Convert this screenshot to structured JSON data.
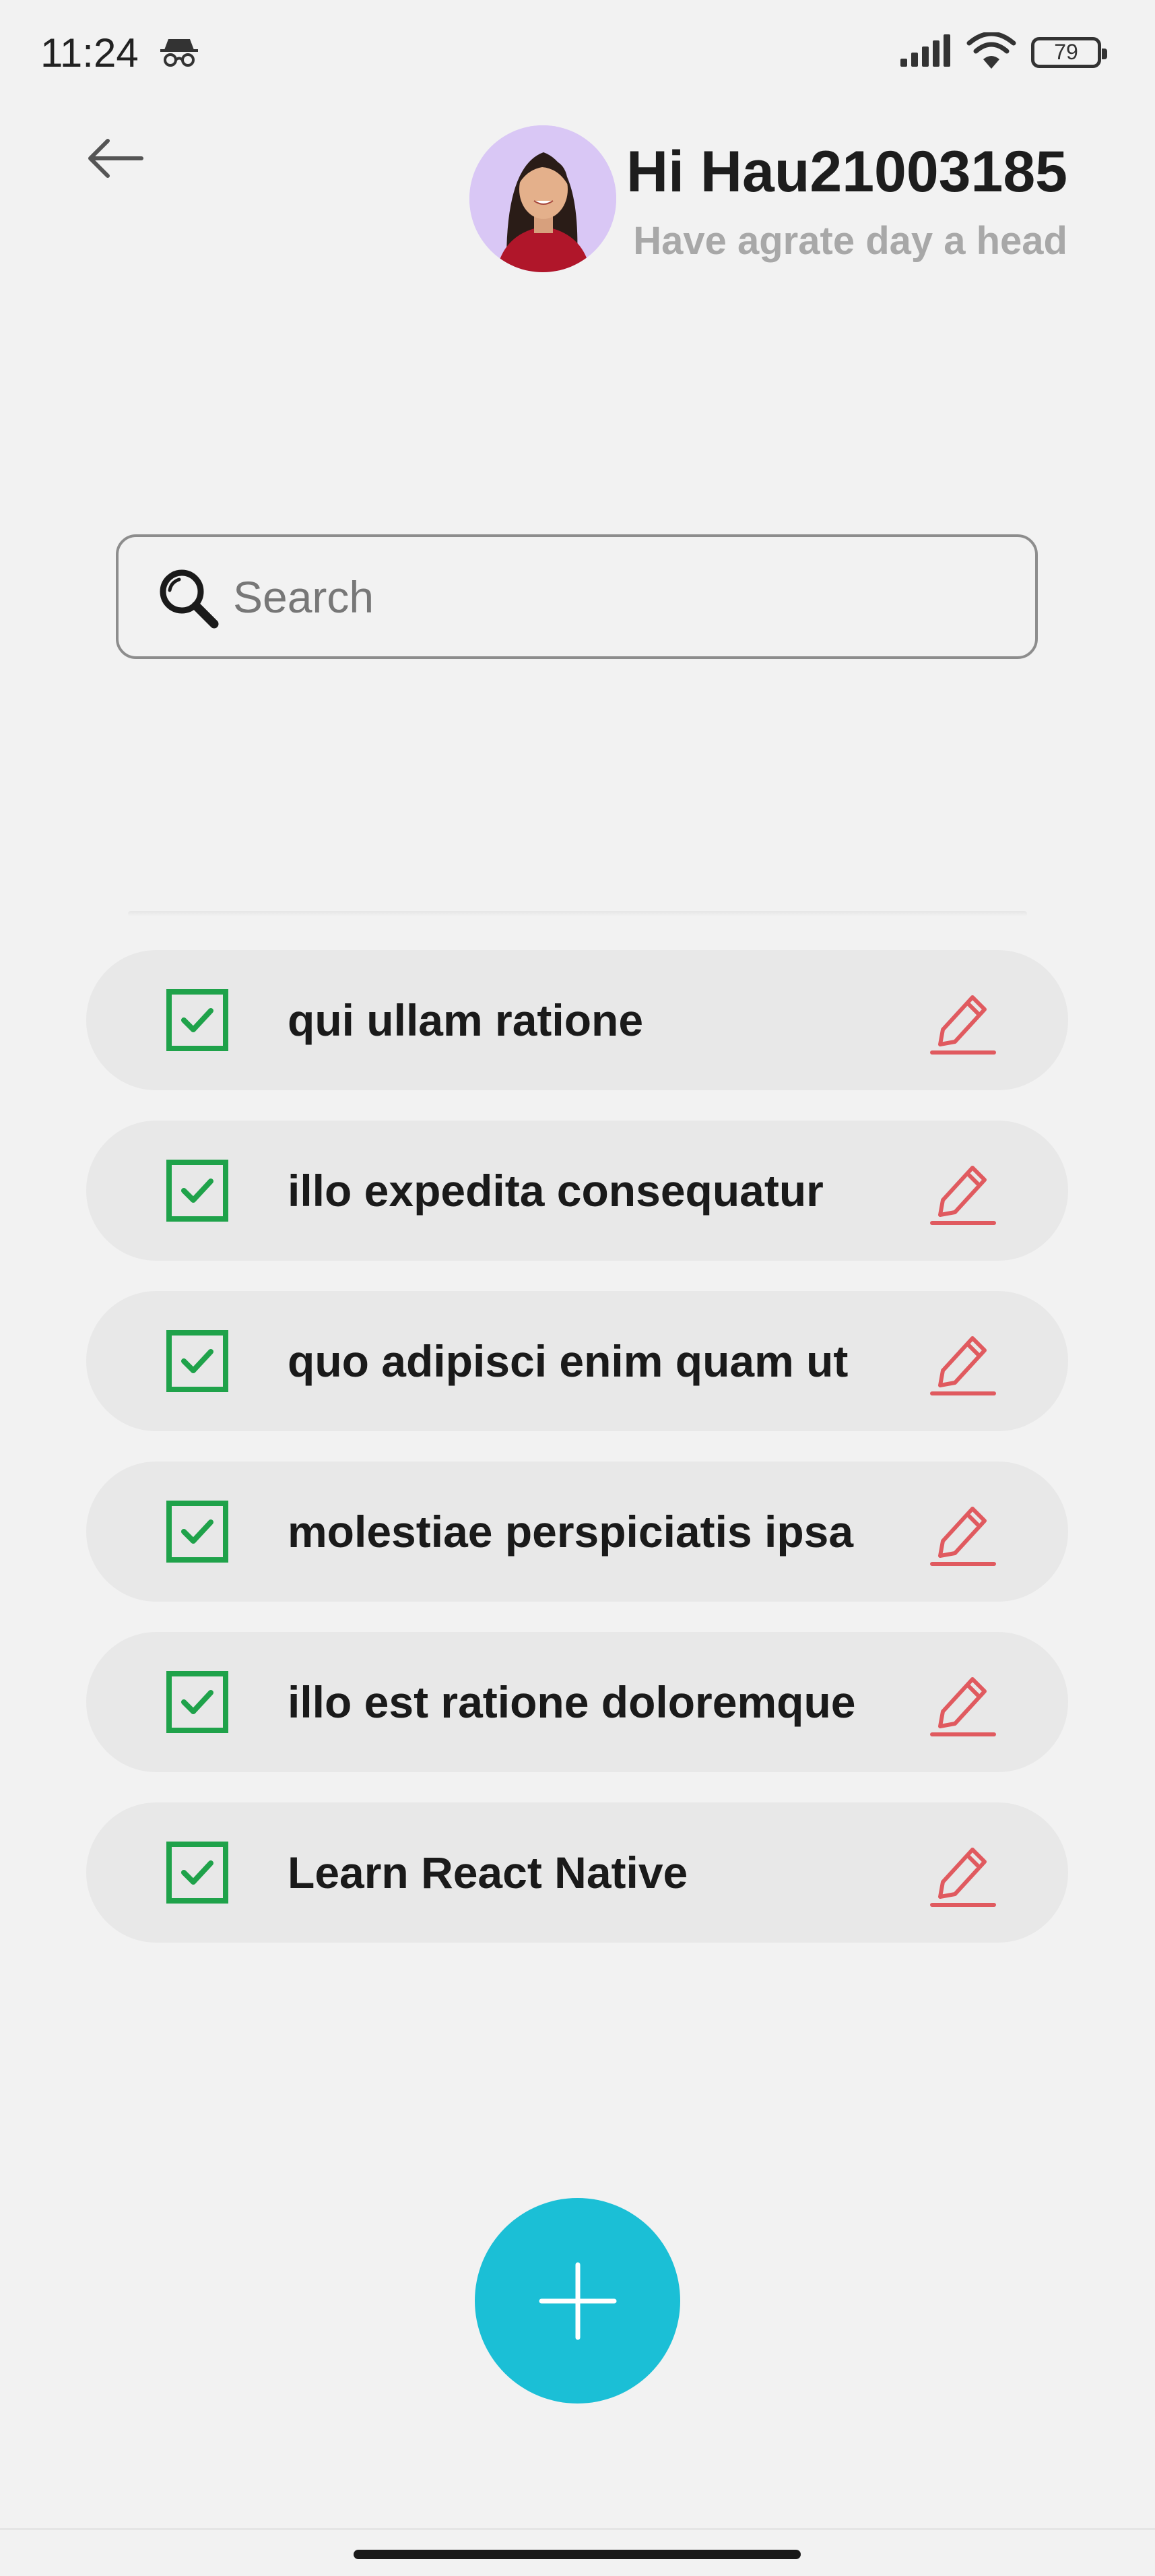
{
  "status_bar": {
    "time": "11:24",
    "battery": "79",
    "icons": [
      "incognito-icon",
      "signal-icon",
      "wifi-icon",
      "battery-icon"
    ]
  },
  "header": {
    "back_icon": "arrow-left-icon",
    "title": "Hi Hau21003185",
    "subtitle": "Have agrate day a head"
  },
  "search": {
    "placeholder": "Search",
    "value": "",
    "icon": "search-icon"
  },
  "todos": [
    {
      "label": "qui ullam ratione",
      "checked": true
    },
    {
      "label": "illo expedita consequatur",
      "checked": true
    },
    {
      "label": "quo adipisci enim quam ut",
      "checked": true
    },
    {
      "label": "molestiae perspiciatis ipsa",
      "checked": true
    },
    {
      "label": "illo est ratione doloremque",
      "checked": true
    },
    {
      "label": "Learn React Native",
      "checked": true
    }
  ],
  "fab": {
    "icon": "plus-icon"
  },
  "colors": {
    "background": "#f2f2f2",
    "accent": "#1bbfd6",
    "check": "#1fa24a",
    "edit": "#e05a5f",
    "item_bg": "#e8e8e8",
    "subtitle": "#a8a8a8"
  }
}
